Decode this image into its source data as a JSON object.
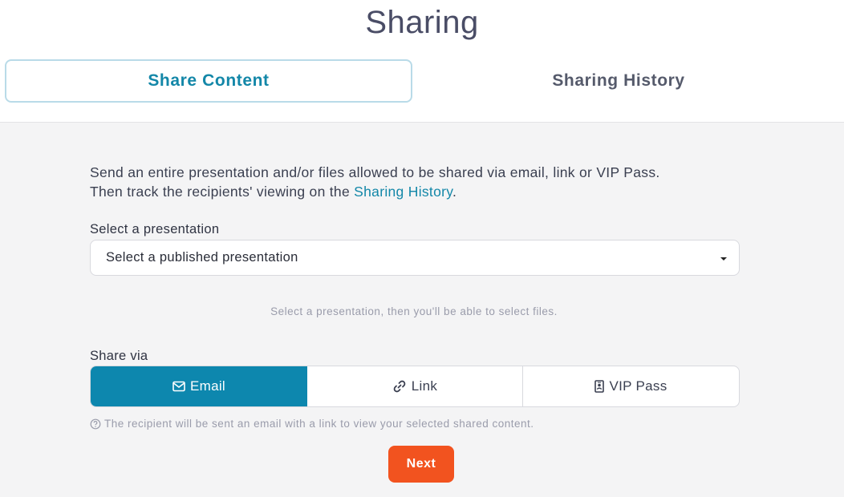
{
  "page": {
    "title": "Sharing"
  },
  "tabs": [
    {
      "label": "Share Content",
      "active": true
    },
    {
      "label": "Sharing History",
      "active": false
    }
  ],
  "intro": {
    "line1": "Send an entire presentation and/or files allowed to be shared via email, link or VIP Pass.",
    "line2_prefix": "Then track the recipients' viewing on the ",
    "line2_link": "Sharing History",
    "line2_suffix": "."
  },
  "presentation": {
    "label": "Select a presentation",
    "selected": "Select a published presentation",
    "hint": "Select a presentation, then you'll be able to select files."
  },
  "share_via": {
    "label": "Share via",
    "options": [
      {
        "label": "Email",
        "icon": "envelope-icon",
        "active": true
      },
      {
        "label": "Link",
        "icon": "link-icon",
        "active": false
      },
      {
        "label": "VIP Pass",
        "icon": "badge-icon",
        "active": false
      }
    ],
    "note": "The recipient will be sent an email with a link to view your selected shared content."
  },
  "actions": {
    "next_label": "Next"
  },
  "colors": {
    "accent": "#0d87ae",
    "tab_active_text": "#1387a8",
    "next_button": "#f2531f",
    "panel_bg": "#f4f4f5"
  }
}
